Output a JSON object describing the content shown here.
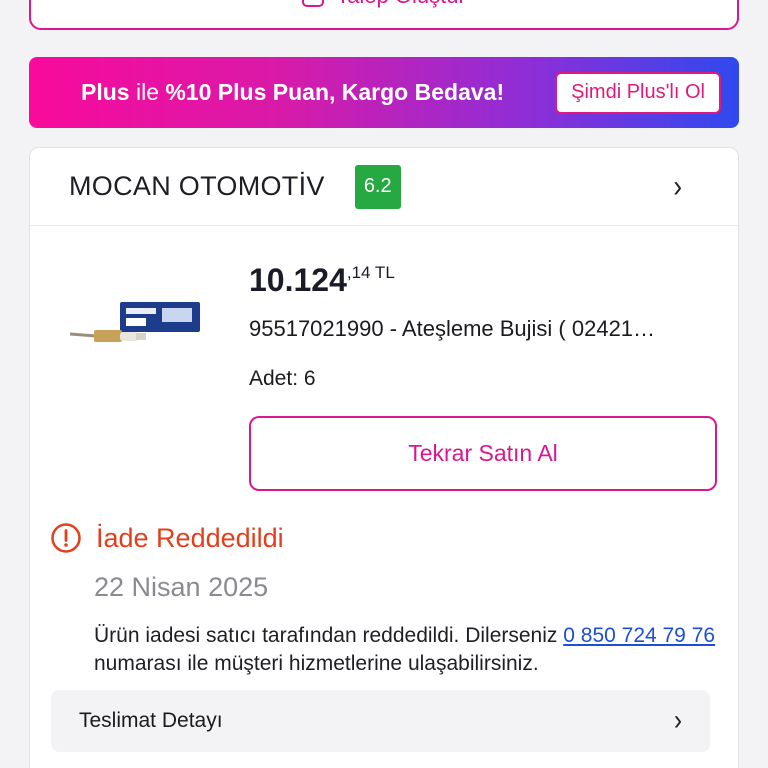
{
  "top_action": {
    "label": "Talep Oluştur"
  },
  "plus_banner": {
    "msg_bold_1": "Plus",
    "msg_thin": " ile ",
    "msg_bold_2": "%10 Plus Puan, Kargo Bedava!",
    "button_label": "Şimdi Plus'lı Ol",
    "gradient_colors": [
      "#f80a9c",
      "#2f49ee"
    ]
  },
  "seller": {
    "name": "MOCAN OTOMOTİV",
    "rating": "6.2",
    "rating_color": "#26a842"
  },
  "product": {
    "price_main": "10.124",
    "price_fraction": ",14",
    "currency": " TL",
    "name": "95517021990 - Ateşleme Bujisi ( 02421…",
    "quantity": "Adet: 6",
    "rebuy_label": "Tekrar Satın Al"
  },
  "return_status": {
    "title": "İade Reddedildi",
    "date": "22 Nisan 2025",
    "desc_before": "Ürün iadesi satıcı tarafından reddedildi. Dilerseniz ",
    "phone": "0 850 724 79 76",
    "desc_after": " numarası ile müşteri hizmetlerine ulaşabilirsiniz.",
    "status_color": "#e2401c"
  },
  "delivery_detail": {
    "label": "Teslimat Detayı"
  },
  "icons": [
    "alert-circle-icon",
    "chevron-right-icon",
    "spark-plug-image"
  ]
}
